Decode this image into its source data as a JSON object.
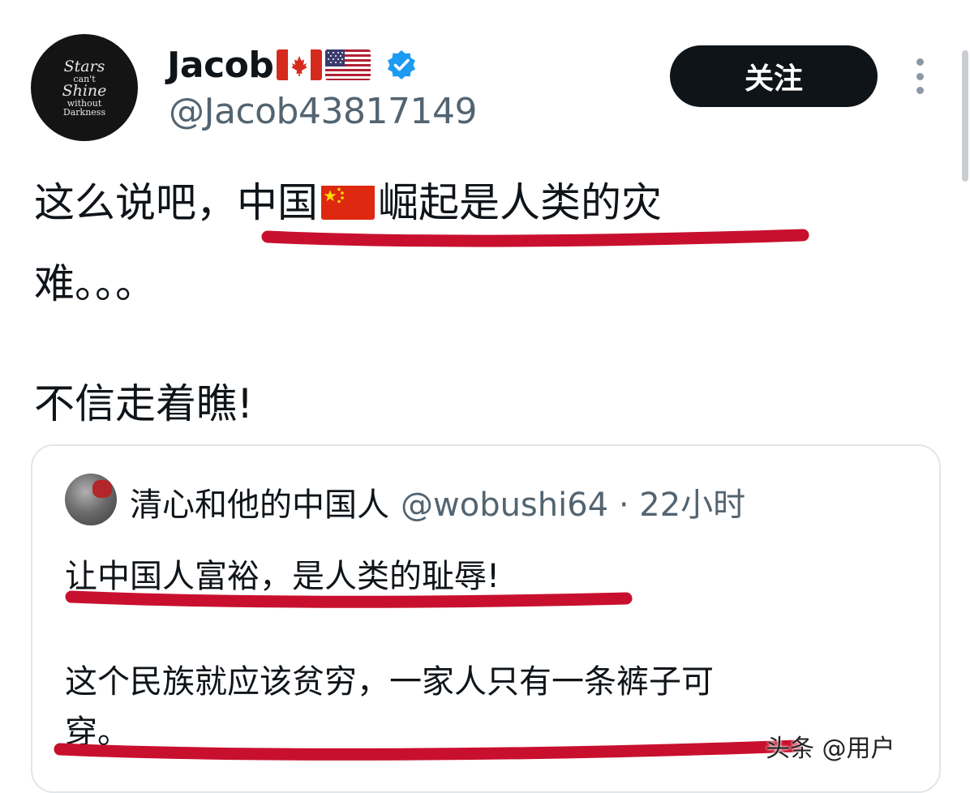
{
  "author": {
    "display_name": "Jacob",
    "handle": "@Jacob43817149",
    "avatar_text": [
      "Stars",
      "can't",
      "Shine",
      "without",
      "Darkness"
    ],
    "flags": [
      "canada-flag-icon",
      "usa-flag-icon"
    ],
    "verified": true
  },
  "follow_button": {
    "label": "关注"
  },
  "tweet": {
    "line1_prefix": "这么说吧，",
    "line1_highlight_a": "中国",
    "line1_highlight_b": "崛起是人类的灾",
    "line2": "难。。。",
    "line3": "不信走着瞧!"
  },
  "quote": {
    "name": "清心和他的中国人",
    "meta": "@wobushi64 · 22小时",
    "line1": "让中国人富裕，是人类的耻辱!",
    "line2": "这个民族就应该贫穷，一家人只有一条裤子可",
    "line3": "穿。"
  },
  "watermark": "头条 @用户",
  "colors": {
    "underline_red": "#c8102e",
    "follow_bg": "#0f1419",
    "verified_blue": "#1d9bf0",
    "secondary_text": "#536471"
  }
}
